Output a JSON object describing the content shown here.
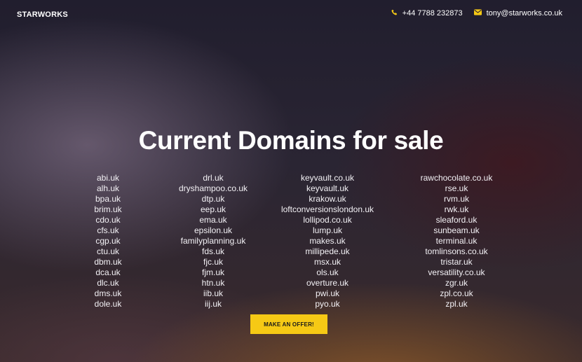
{
  "header": {
    "brand": "STARWORKS",
    "phone": "+44 7788 232873",
    "email": "tony@starworks.co.uk",
    "phone_icon": "phone-icon",
    "email_icon": "envelope-icon",
    "icon_color": "#f6c915"
  },
  "main": {
    "title": "Current Domains for sale",
    "columns": [
      [
        "abi.uk",
        "alh.uk",
        "bpa.uk",
        "brim.uk",
        "cdo.uk",
        "cfs.uk",
        "cgp.uk",
        "ctu.uk",
        "dbm.uk",
        "dca.uk",
        "dlc.uk",
        "dms.uk",
        "dole.uk"
      ],
      [
        "drl.uk",
        "dryshampoo.co.uk",
        "dtp.uk",
        "eep.uk",
        "ema.uk",
        "epsilon.uk",
        "familyplanning.uk",
        "fds.uk",
        "fjc.uk",
        "fjm.uk",
        "htn.uk",
        "iib.uk",
        "iij.uk"
      ],
      [
        "keyvault.co.uk",
        "keyvault.uk",
        "krakow.uk",
        "loftconversionslondon.uk",
        "lollipod.co.uk",
        "lump.uk",
        "makes.uk",
        "millipede.uk",
        "msx.uk",
        "ols.uk",
        "overture.uk",
        "pwi.uk",
        "pyo.uk"
      ],
      [
        "rawchocolate.co.uk",
        "rse.uk",
        "rvm.uk",
        "rwk.uk",
        "sleaford.uk",
        "sunbeam.uk",
        "terminal.uk",
        "tomlinsons.co.uk",
        "tristar.uk",
        "versatility.co.uk",
        "zgr.uk",
        "zpl.co.uk",
        "zpl.uk"
      ]
    ],
    "offer_button": "MAKE AN OFFER!",
    "accent_color": "#f6c915"
  }
}
